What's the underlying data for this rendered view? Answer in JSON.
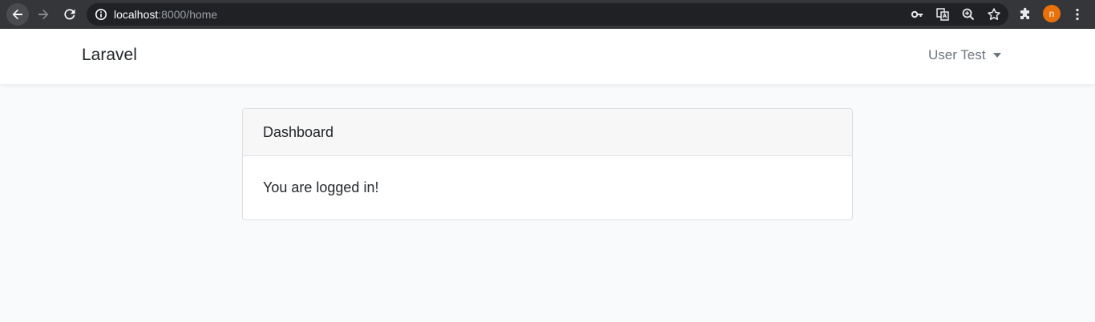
{
  "browser": {
    "url_host": "localhost",
    "url_rest": ":8000/home",
    "profile_initial": "n",
    "profile_color": "#e8710a"
  },
  "navbar": {
    "brand": "Laravel",
    "user_name": "User Test"
  },
  "card": {
    "header": "Dashboard",
    "body": "You are logged in!"
  }
}
